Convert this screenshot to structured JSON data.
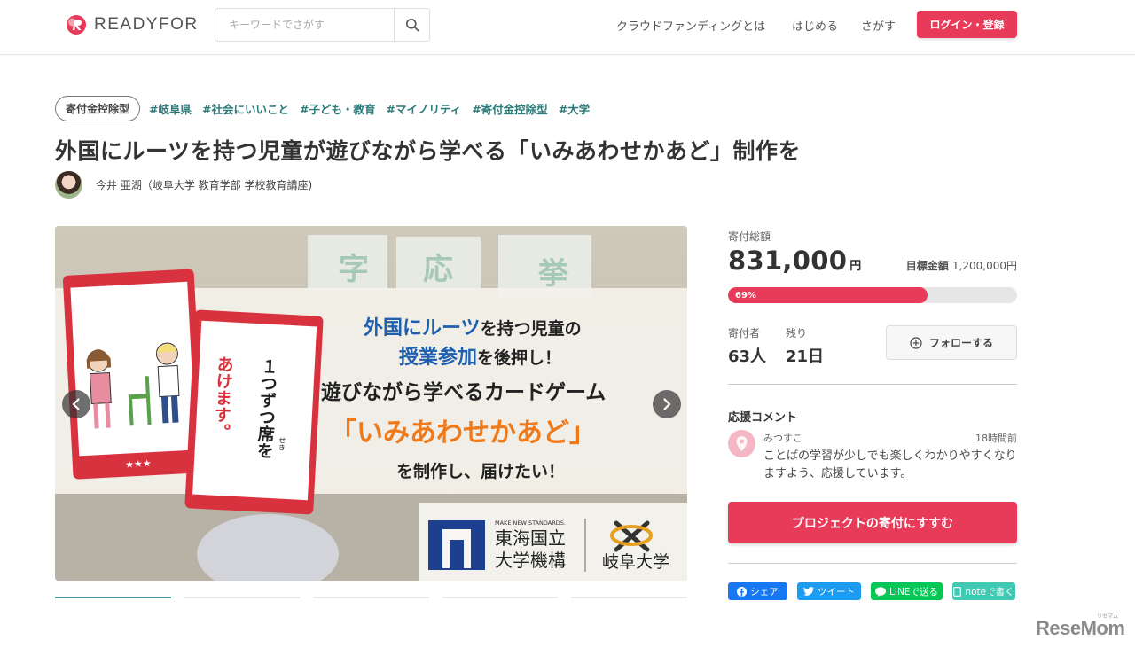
{
  "header": {
    "logo_text": "READYFOR",
    "search_placeholder": "キーワードでさがす",
    "nav": [
      "クラウドファンディングとは",
      "はじめる",
      "さがす"
    ],
    "login_label": "ログイン・登録"
  },
  "project": {
    "badge": "寄付金控除型",
    "tags": [
      "#岐阜県",
      "#社会にいいこと",
      "#子ども・教育",
      "#マイノリティ",
      "#寄付金控除型",
      "#大学"
    ],
    "title": "外国にルーツを持つ児童が遊びながら学べる「いみあわせかあど」制作を",
    "author": "今井 亜湖（岐阜大学 教育学部 学校教育講座)"
  },
  "hero": {
    "line1_a": "外国にルーツ",
    "line1_b": "を持つ児童の",
    "line2_a": "授業参加",
    "line2_b": "を後押し！",
    "line3": "遊びながら学べるカードゲーム",
    "line4": "「いみあわせかあど」",
    "line5": "を制作し、届けたい！",
    "card_front": "１つずつ席を",
    "card_ruby": "せき",
    "card_back": "あけます。",
    "card_stars": "★★★",
    "logo1_tag": "MAKE NEW STANDARDS.",
    "logo1_line1": "東海国立",
    "logo1_line2": "大学機構",
    "logo2_name": "岐阜大学",
    "bg_chars": [
      "字",
      "応",
      "挙"
    ],
    "thumb_count": 5,
    "active_thumb": 0
  },
  "sidebar": {
    "total_label": "寄付総額",
    "total_amount": "831,000",
    "yen": "円",
    "goal_label": "目標金額",
    "goal_amount": "1,200,000円",
    "progress_percent": 69,
    "progress_text": "69%",
    "donors_label": "寄付者",
    "donors_value": "63人",
    "remaining_label": "残り",
    "remaining_value": "21日",
    "follow_label": "フォローする",
    "cheer_heading": "応援コメント",
    "comment": {
      "name": "みつすこ",
      "time": "18時間前",
      "text": "ことばの学習が少しでも楽しくわかりやすくなりますよう、応援しています。"
    },
    "donate_label": "プロジェクトの寄付にすすむ",
    "share": [
      {
        "label": "シェア",
        "icon": "facebook-icon",
        "color": "#1877f2"
      },
      {
        "label": "ツイート",
        "icon": "twitter-icon",
        "color": "#1d9bf0"
      },
      {
        "label": "LINEで送る",
        "icon": "line-icon",
        "color": "#06c755"
      },
      {
        "label": "noteで書く",
        "icon": "note-icon",
        "color": "#41c9b4"
      }
    ]
  },
  "colors": {
    "accent": "#e83b5a",
    "tag": "#2b7a7a",
    "hero_blue": "#1f5fae",
    "hero_orange": "#ee7a1c",
    "card_red": "#d8323f"
  },
  "watermark": {
    "text": "ReseMom",
    "ruby": "リセマム"
  }
}
